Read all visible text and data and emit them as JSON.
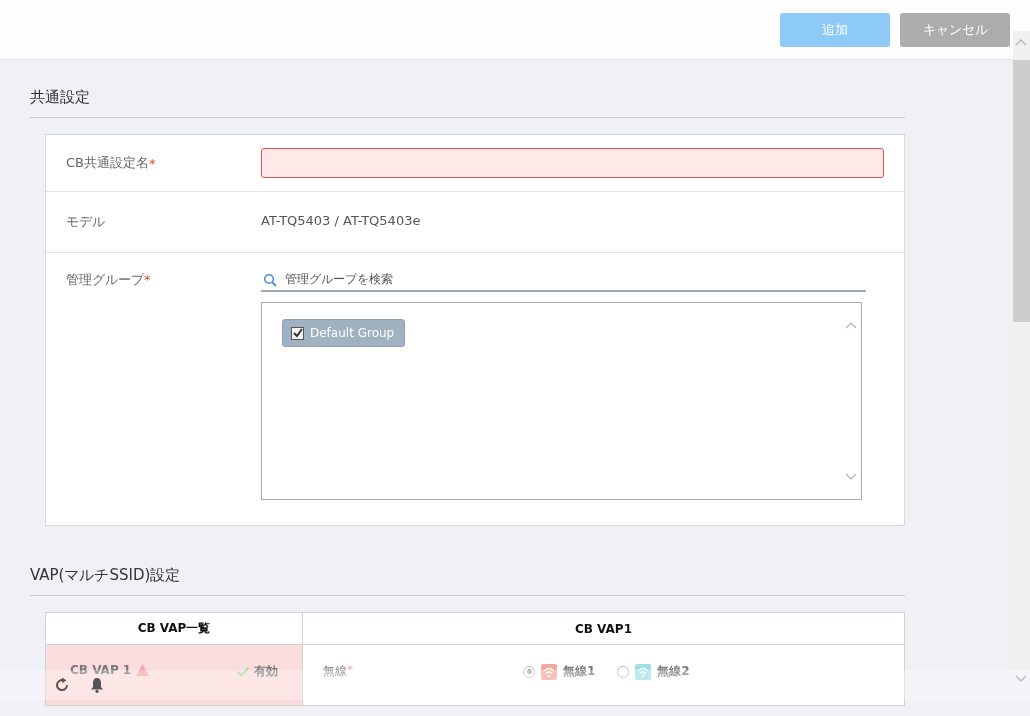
{
  "toolbar": {
    "buttons": [
      {
        "label": "追加",
        "kind": "primary"
      },
      {
        "label": "キャンセル",
        "kind": "secondary"
      }
    ]
  },
  "common": {
    "title": "共通設定",
    "rows": [
      {
        "kind": "input",
        "label": "CB共通設定名",
        "required_mark": "*",
        "invalid": true
      },
      {
        "kind": "text",
        "label": "モデル",
        "value": "AT-TQ5403 / AT-TQ5403e"
      },
      {
        "kind": "groups",
        "label": "管理グループ",
        "required_mark": "*",
        "search_placeholder": "管理グループを検索",
        "items": [
          {
            "label": "Default Group",
            "checked": true
          }
        ]
      }
    ]
  },
  "vap": {
    "title": "VAP(マルチSSID)設定",
    "list_header": "CB VAP一覧",
    "detail_header": "CB VAP1",
    "list": [
      {
        "name": "CB VAP 1",
        "warning": true,
        "status": "有効",
        "enabled": true,
        "selected": true
      }
    ],
    "detail": {
      "label": "無線",
      "required_mark": "*",
      "options": [
        {
          "label": "無線1",
          "selected": true,
          "color": "#f4a8a0"
        },
        {
          "label": "無線2",
          "selected": false,
          "color": "#9fdfe8"
        }
      ]
    }
  }
}
